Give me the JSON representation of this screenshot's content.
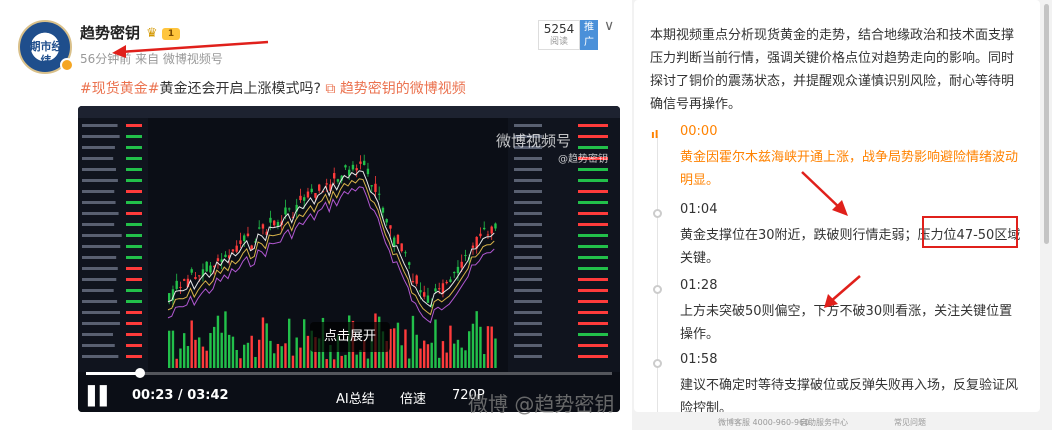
{
  "post": {
    "avatar_text": "期市经纬",
    "username": "趋势密钥",
    "level": "1",
    "meta": "56分钟前 来自 微博视频号",
    "topic": "#现货黄金#",
    "title_text": "黄金还会开启上涨模式吗?",
    "video_link": "趋势密钥的微博视频",
    "read_count": "5254",
    "read_label": "阅读",
    "promote_label": "推广"
  },
  "video": {
    "watermark": "微博视频号",
    "watermark_sub": "@趋势密钥",
    "expand_label": "点击展开",
    "current_time": "00:23",
    "duration": "03:42",
    "progress": 0.103,
    "ai_label": "AI总结",
    "speed_label": "倍速",
    "resolution_label": "720P"
  },
  "bottom_watermark": "微博 @趋势密钥",
  "panel": {
    "summary": "本期视频重点分析现货黄金的走势，结合地缘政治和技术面支撑压力判断当前行情，强调关键价格点位对趋势走向的影响。同时探讨了铜价的震荡状态，并提醒观众谨慎识别风险，耐心等待明确信号再操作。",
    "timeline": [
      {
        "time": "00:00",
        "text": "黄金因霍尔木兹海峡开通上涨，战争局势影响避险情绪波动明显。",
        "active": true
      },
      {
        "time": "01:04",
        "text": "黄金支撑位在30附近，跌破则行情走弱；压力位47-50区域关键。",
        "active": false
      },
      {
        "time": "01:28",
        "text": "上方未突破50则偏空，下方不破30则看涨，关注关键位置操作。",
        "active": false
      },
      {
        "time": "01:58",
        "text": "建议不确定时等待支撑破位或反弹失败再入场，反复验证风险控制。",
        "active": false
      }
    ]
  },
  "footer": {
    "hotline": "微博客服 4000-960-960",
    "help": "自助服务中心",
    "faq": "常见问题"
  },
  "colors": {
    "accent": "#ff8200",
    "link": "#eb7350",
    "annotation": "#e0201b",
    "candle_up": "#ff3b3b",
    "candle_down": "#22c04a"
  }
}
